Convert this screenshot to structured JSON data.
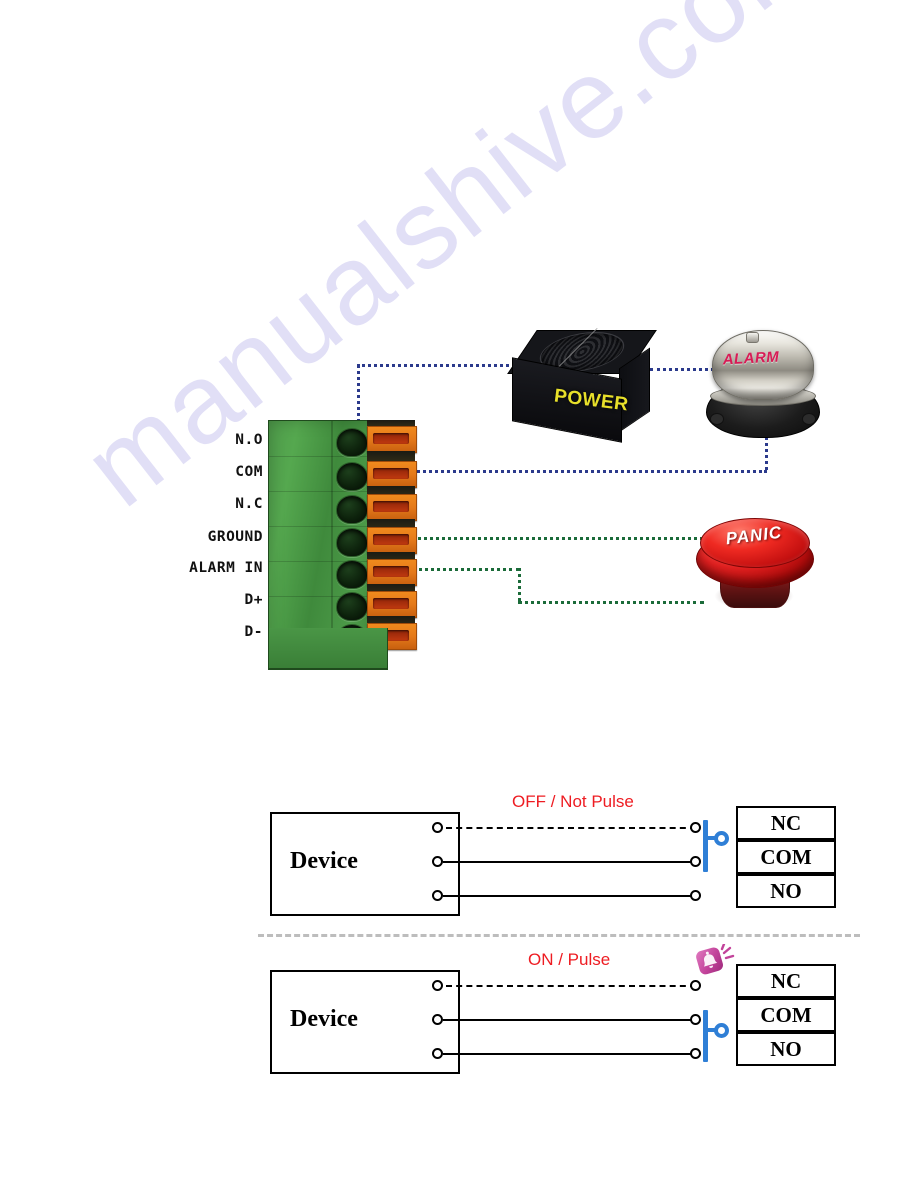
{
  "document": {
    "watermark": "manualshive.com"
  },
  "terminal_block": {
    "name": "alarm-terminal-block",
    "pins": [
      {
        "label": "N.O"
      },
      {
        "label": "COM"
      },
      {
        "label": "N.C"
      },
      {
        "label": "GROUND"
      },
      {
        "label": "ALARM IN"
      },
      {
        "label": "D+"
      },
      {
        "label": "D-"
      }
    ]
  },
  "devices": {
    "power_supply": {
      "label": "POWER",
      "icon": "power-supply-icon",
      "text_color": "#e8e02a"
    },
    "alarm_bell": {
      "label": "ALARM",
      "icon": "alarm-bell-icon",
      "text_color": "#d81b56"
    },
    "panic_button": {
      "label": "PANIC",
      "icon": "panic-button-icon",
      "text_color": "#ffffff"
    }
  },
  "wiring": {
    "power_line_color": "#2b3a8c",
    "panic_line_color": "#1b6b39",
    "connections": [
      {
        "from": "N.O",
        "to": "POWER"
      },
      {
        "from": "POWER",
        "to": "ALARM"
      },
      {
        "from": "ALARM",
        "to": "COM"
      },
      {
        "from": "GROUND",
        "to": "PANIC"
      },
      {
        "from": "ALARM IN",
        "to": "PANIC"
      }
    ]
  },
  "circuits": [
    {
      "id": "circuit-off",
      "device_label": "Device",
      "mode_label": "OFF / Not Pulse",
      "mode_color": "#ee1c22",
      "switch_color": "#2f7fd6",
      "switch_position": "nc-com",
      "terminals": [
        "NC",
        "COM",
        "NO"
      ],
      "wires": [
        {
          "terminal": "NC",
          "style": "dashed"
        },
        {
          "terminal": "COM",
          "style": "solid"
        },
        {
          "terminal": "NO",
          "style": "solid"
        }
      ],
      "badge": null
    },
    {
      "id": "circuit-on",
      "device_label": "Device",
      "mode_label": "ON / Pulse",
      "mode_color": "#ee1c22",
      "switch_color": "#2f7fd6",
      "switch_position": "com-no",
      "terminals": [
        "NC",
        "COM",
        "NO"
      ],
      "wires": [
        {
          "terminal": "NC",
          "style": "dashed"
        },
        {
          "terminal": "COM",
          "style": "solid"
        },
        {
          "terminal": "NO",
          "style": "solid"
        }
      ],
      "badge": "bell-ringing-icon"
    }
  ],
  "divider": {
    "color": "#bdbdbd",
    "style": "dashed"
  }
}
